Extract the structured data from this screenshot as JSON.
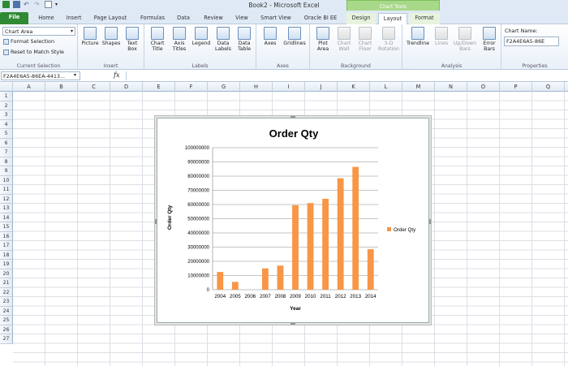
{
  "window": {
    "title": "Book2 - Microsoft Excel",
    "context_tab_group": "Chart Tools"
  },
  "tabs": [
    "File",
    "Home",
    "Insert",
    "Page Layout",
    "Formulas",
    "Data",
    "Review",
    "View",
    "Smart View",
    "Oracle BI EE",
    "Design",
    "Layout",
    "Format"
  ],
  "ribbon": {
    "current_selection": {
      "dropdown_value": "Chart Area",
      "format_selection": "Format Selection",
      "reset_style": "Reset to Match Style",
      "label": "Current Selection"
    },
    "insert": {
      "label": "Insert",
      "buttons": [
        "Picture",
        "Shapes",
        "Text Box"
      ]
    },
    "labels": {
      "label": "Labels",
      "buttons": [
        "Chart Title",
        "Axis Titles",
        "Legend",
        "Data Labels",
        "Data Table"
      ]
    },
    "axes": {
      "label": "Axes",
      "buttons": [
        "Axes",
        "Gridlines"
      ]
    },
    "background": {
      "label": "Background",
      "buttons": [
        "Plot Area",
        "Chart Wall",
        "Chart Floor",
        "3-D Rotation"
      ]
    },
    "analysis": {
      "label": "Analysis",
      "buttons": [
        "Trendline",
        "Lines",
        "Up/Down Bars",
        "Error Bars"
      ]
    },
    "properties": {
      "label": "Properties",
      "chart_name_label": "Chart Name:",
      "chart_name_value": "F2A4E6A5-86E"
    }
  },
  "formula_bar": {
    "name_box": "F2A4E6A5-86EA-4413...",
    "fx": "fx",
    "formula": ""
  },
  "sheet": {
    "columns": [
      "A",
      "B",
      "C",
      "D",
      "E",
      "F",
      "G",
      "H",
      "I",
      "J",
      "K",
      "L",
      "M",
      "N",
      "O",
      "P",
      "Q"
    ],
    "rows": [
      "1",
      "2",
      "3",
      "4",
      "5",
      "6",
      "7",
      "8",
      "9",
      "10",
      "11",
      "12",
      "13",
      "14",
      "15",
      "16",
      "17",
      "18",
      "19",
      "20",
      "21",
      "22",
      "23",
      "24",
      "25",
      "26",
      "27"
    ]
  },
  "colors": {
    "bar": "#f79646",
    "file_tab": "#2f8a33",
    "context_tab": "#a8d88a"
  },
  "chart_data": {
    "type": "bar",
    "title": "Order Qty",
    "xlabel": "Year",
    "ylabel": "Order Qty",
    "categories": [
      "2004",
      "2005",
      "2006",
      "2007",
      "2008",
      "2009",
      "2010",
      "2011",
      "2012",
      "2013",
      "2014"
    ],
    "series": [
      {
        "name": "Order Qty",
        "values": [
          12500000,
          5500000,
          0,
          15000000,
          17000000,
          59500000,
          61000000,
          64000000,
          78500000,
          86500000,
          28500000
        ]
      }
    ],
    "yticks": [
      "0",
      "10000000",
      "20000000",
      "30000000",
      "40000000",
      "50000000",
      "60000000",
      "70000000",
      "80000000",
      "90000000",
      "100000000"
    ],
    "ylim": [
      0,
      100000000
    ],
    "grid": true,
    "legend_position": "right"
  }
}
